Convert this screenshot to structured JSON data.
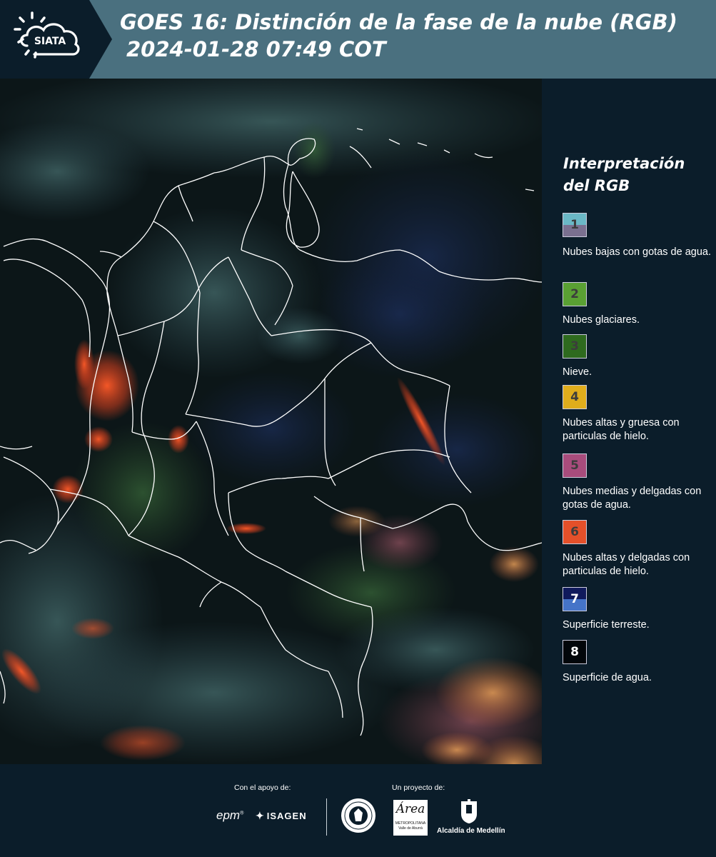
{
  "header": {
    "logo_text": "SIATA",
    "title_line1": "GOES 16: Distinción de la fase de la nube (RGB)",
    "title_line2": "2024-01-28 07:49 COT"
  },
  "legend": {
    "title_line1": "Interpretación",
    "title_line2": "del RGB",
    "items": [
      {
        "number": "1",
        "label": "Nubes bajas con gotas de agua.",
        "color_top": "#6ab8c6",
        "color_bottom": "#7a7090"
      },
      {
        "number": "2",
        "label": "Nubes glaciares.",
        "color_top": "#5aa033",
        "color_bottom": "#5aa033"
      },
      {
        "number": "3",
        "label": "Nieve.",
        "color_top": "#2e6a1e",
        "color_bottom": "#2e6a1e"
      },
      {
        "number": "4",
        "label": "Nubes altas y gruesa con particulas de hielo.",
        "color_top": "#e0ad1c",
        "color_bottom": "#e0ad1c"
      },
      {
        "number": "5",
        "label": "Nubes medias y delgadas con gotas de agua.",
        "color_top": "#a84c7c",
        "color_bottom": "#a84c7c"
      },
      {
        "number": "6",
        "label": "Nubes altas y delgadas con particulas de hielo.",
        "color_top": "#e4502a",
        "color_bottom": "#e4502a"
      },
      {
        "number": "7",
        "label": "Superficie terreste.",
        "color_top": "#101a5c",
        "color_bottom": "#4574c8"
      },
      {
        "number": "8",
        "label": "Superficie de agua.",
        "color_top": "#02060a",
        "color_bottom": "#02060a"
      }
    ]
  },
  "footer": {
    "support_label": "Con el apoyo de:",
    "project_label": "Un proyecto de:",
    "partner_epm": "epm",
    "partner_epm_mark": "®",
    "partner_isagen": "ISAGEN",
    "area_logo_script": "Área",
    "area_line1": "METROPOLITANA",
    "area_line2": "Valle de Aburrá",
    "alcaldia_label": "Alcaldía de Medellín"
  },
  "colors": {
    "header_bar": "#4a707f",
    "background": "#0b1d2a",
    "boundary_line": "#ffffff"
  }
}
